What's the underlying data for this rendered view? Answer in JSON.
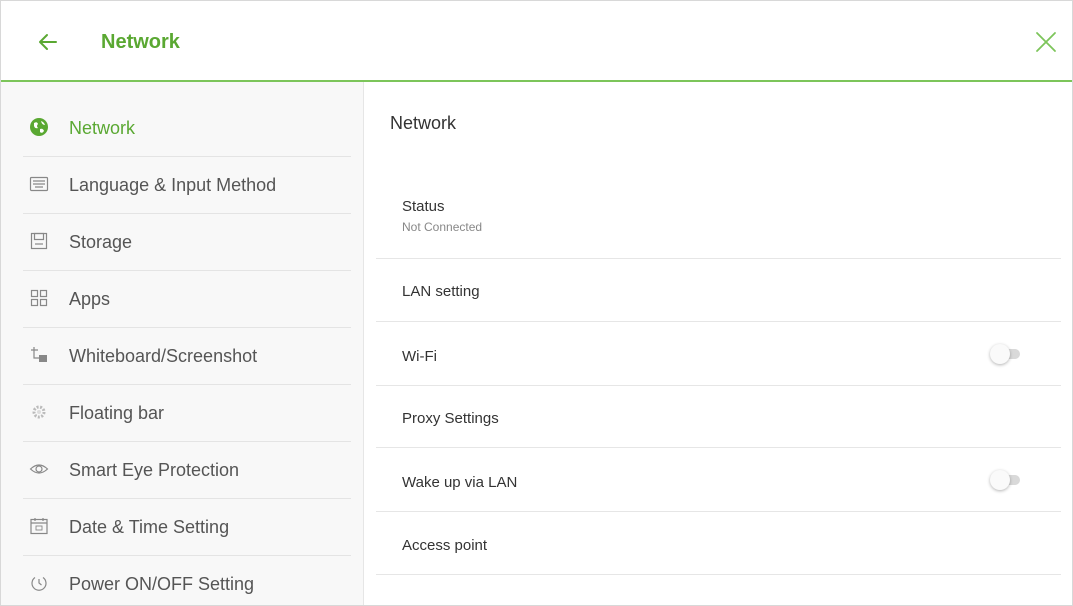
{
  "header": {
    "title": "Network"
  },
  "sidebar": {
    "items": [
      {
        "label": "Network",
        "icon": "globe-icon",
        "active": true
      },
      {
        "label": "Language & Input Method",
        "icon": "keyboard-icon"
      },
      {
        "label": "Storage",
        "icon": "storage-icon"
      },
      {
        "label": "Apps",
        "icon": "apps-grid-icon"
      },
      {
        "label": "Whiteboard/Screenshot",
        "icon": "whiteboard-icon"
      },
      {
        "label": "Floating bar",
        "icon": "gear-icon"
      },
      {
        "label": "Smart Eye Protection",
        "icon": "eye-icon"
      },
      {
        "label": "Date & Time Setting",
        "icon": "calendar-icon"
      },
      {
        "label": "Power ON/OFF Setting",
        "icon": "power-icon"
      }
    ]
  },
  "content": {
    "title": "Network",
    "status": {
      "label": "Status",
      "value": "Not Connected"
    },
    "lan": {
      "label": "LAN setting"
    },
    "wifi": {
      "label": "Wi-Fi",
      "enabled": false
    },
    "proxy": {
      "label": "Proxy Settings"
    },
    "wake_lan": {
      "label": "Wake up via LAN",
      "enabled": false
    },
    "access_point": {
      "label": "Access point"
    }
  },
  "colors": {
    "accent": "#5aa832",
    "header_line": "#7cc55a",
    "toggle_off": "#d9d9d9"
  }
}
